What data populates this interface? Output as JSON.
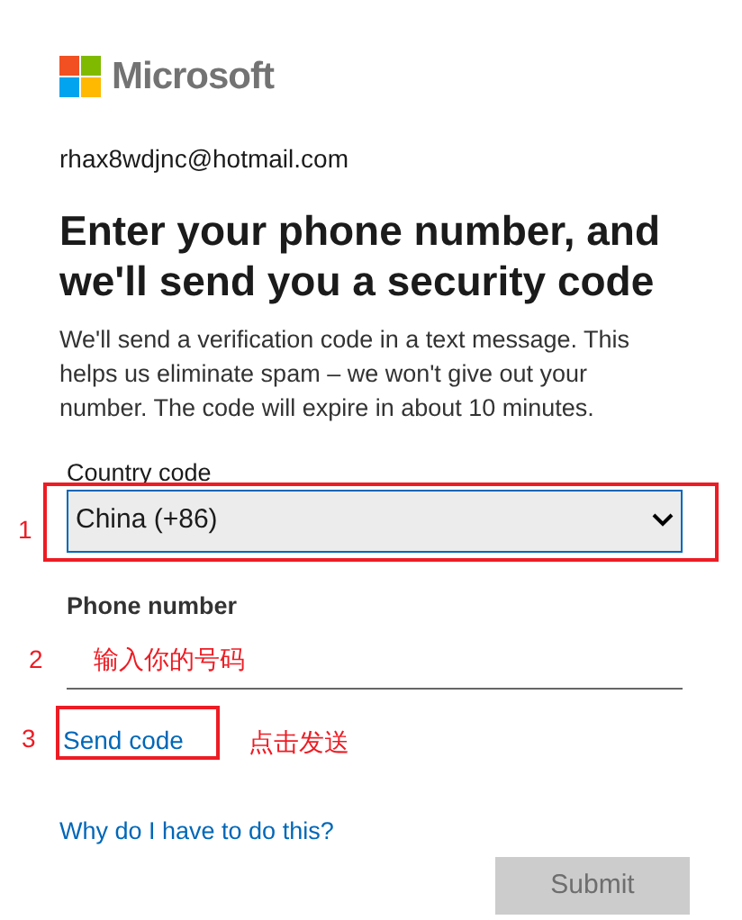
{
  "logo": {
    "text": "Microsoft"
  },
  "account": "rhax8wdjnc@hotmail.com",
  "heading": "Enter your phone number, and we'll send you a security code",
  "description": "We'll send a verification code in a text message. This helps us eliminate spam – we won't give out your number. The code will expire in about 10 minutes.",
  "country_field": {
    "label": "Country code",
    "value": "China (+86)"
  },
  "phone_field": {
    "label": "Phone number"
  },
  "send_code_link": "Send code",
  "why_link": "Why do I have to do this?",
  "submit_button": {
    "label": "Submit",
    "disabled": true
  },
  "annotations": [
    {
      "number": "1"
    },
    {
      "number": "2",
      "note": "输入你的号码"
    },
    {
      "number": "3",
      "note": "点击发送"
    }
  ]
}
